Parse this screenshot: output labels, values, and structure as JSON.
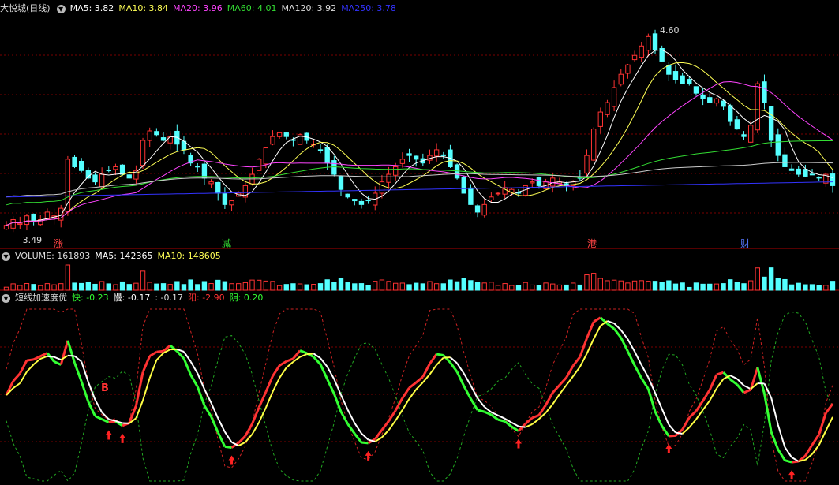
{
  "colors": {
    "bg": "#000000",
    "grid": "#7a0000",
    "up": "#ff3333",
    "down": "#54ffff",
    "ma5": "#ffffff",
    "ma10": "#ffff55",
    "ma20": "#ff44ff",
    "ma60": "#33dd33",
    "ma120": "#cccccc",
    "ma250": "#3333ff",
    "quick": "#33ff33",
    "slow": "#ffffff",
    "pos": "#ff3333",
    "neg": "#33ff33"
  },
  "main": {
    "title": "大悦城(日线)",
    "legend": [
      {
        "label": "MA5: 3.82",
        "color": "#ffffff"
      },
      {
        "label": "MA10: 3.84",
        "color": "#ffff55"
      },
      {
        "label": "MA20: 3.96",
        "color": "#ff44ff"
      },
      {
        "label": "MA60: 4.01",
        "color": "#33dd33"
      },
      {
        "label": "MA120: 3.92",
        "color": "#dddddd"
      },
      {
        "label": "MA250: 3.78",
        "color": "#3333ff"
      }
    ],
    "high_label": "4.60",
    "low_label": "3.49",
    "event_marks": [
      {
        "label": "涨",
        "color": "#ff4444"
      },
      {
        "label": "减",
        "color": "#33dd33"
      },
      {
        "label": "港",
        "color": "#ff4444"
      },
      {
        "label": "财",
        "color": "#5577ff"
      }
    ]
  },
  "volume": {
    "legend": [
      {
        "label": "VOLUME: 161893",
        "color": "#dddddd"
      },
      {
        "label": "MA5: 142365",
        "color": "#ffffff"
      },
      {
        "label": "MA10: 148605",
        "color": "#ffff55"
      }
    ]
  },
  "indicator": {
    "legend": [
      {
        "label": "短线加速度优",
        "color": "#dddddd"
      },
      {
        "label": "快: -0.23",
        "color": "#33ff33"
      },
      {
        "label": "慢: -0.17",
        "color": "#ffffff"
      },
      {
        "label": ": -0.17",
        "color": "#dddddd"
      },
      {
        "label": "阳: -2.90",
        "color": "#ff3333"
      },
      {
        "label": "阴: 0.20",
        "color": "#33ff33"
      }
    ],
    "signal_label": "B"
  },
  "chart_data": {
    "type": "candlestick",
    "title": "大悦城(日线)",
    "xlabel": "",
    "ylabel": "",
    "ylim": [
      3.44,
      4.66
    ],
    "grid": true,
    "price_low": 3.49,
    "price_high": 4.6,
    "ma_last": {
      "MA5": 3.82,
      "MA10": 3.84,
      "MA20": 3.96,
      "MA60": 4.01,
      "MA120": 3.92,
      "MA250": 3.78
    },
    "closes": [
      3.55,
      3.58,
      3.56,
      3.6,
      3.57,
      3.58,
      3.62,
      3.6,
      3.64,
      3.9,
      3.86,
      3.84,
      3.8,
      3.78,
      3.82,
      3.84,
      3.86,
      3.82,
      3.8,
      3.84,
      4.0,
      4.05,
      4.03,
      4.0,
      4.02,
      3.98,
      3.95,
      3.88,
      3.86,
      3.8,
      3.78,
      3.72,
      3.66,
      3.68,
      3.72,
      3.76,
      3.82,
      3.9,
      3.96,
      4.02,
      4.04,
      4.02,
      4.0,
      4.03,
      4.0,
      3.98,
      3.95,
      3.88,
      3.82,
      3.74,
      3.7,
      3.68,
      3.66,
      3.68,
      3.72,
      3.78,
      3.82,
      3.86,
      3.9,
      3.92,
      3.9,
      3.88,
      3.92,
      3.95,
      3.92,
      3.86,
      3.8,
      3.72,
      3.66,
      3.62,
      3.66,
      3.7,
      3.72,
      3.75,
      3.74,
      3.72,
      3.76,
      3.78,
      3.76,
      3.78,
      3.8,
      3.78,
      3.76,
      3.78,
      3.8,
      3.92,
      4.06,
      4.15,
      4.2,
      4.28,
      4.35,
      4.4,
      4.45,
      4.5,
      4.55,
      4.48,
      4.42,
      4.35,
      4.32,
      4.3,
      4.3,
      4.25,
      4.22,
      4.2,
      4.22,
      4.18,
      4.1,
      4.06,
      4.02,
      4.08,
      4.3,
      4.2,
      4.0,
      3.92,
      3.86,
      3.84,
      3.82,
      3.81,
      3.82,
      3.8,
      3.82,
      3.76
    ],
    "volume": {
      "last": 161893,
      "ma5": 142365,
      "ma10": 148605
    },
    "indicator": {
      "name": "短线加速度优",
      "fast": -0.23,
      "slow": -0.17,
      "value": -0.17,
      "yang": -2.9,
      "yin": 0.2
    }
  }
}
